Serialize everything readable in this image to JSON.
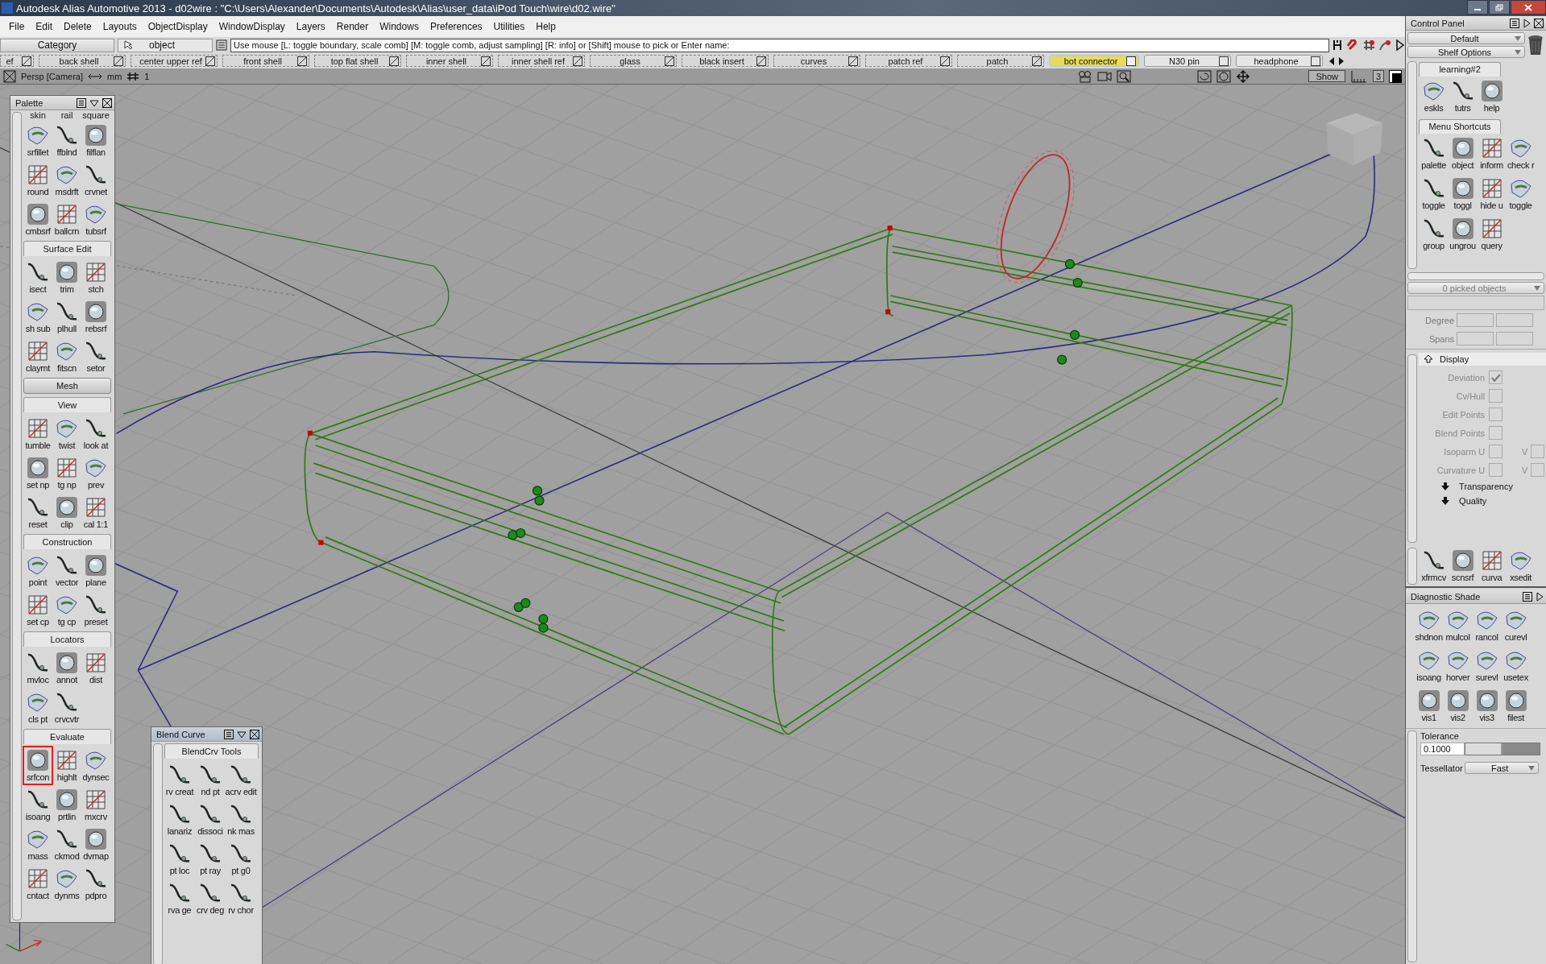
{
  "window": {
    "title": "Autodesk Alias Automotive 2013 - d02wire : \"C:\\Users\\Alexander\\Documents\\Autodesk\\Alias\\user_data\\iPod Touch\\wire\\d02.wire\""
  },
  "menu": [
    "File",
    "Edit",
    "Delete",
    "Layouts",
    "ObjectDisplay",
    "WindowDisplay",
    "Layers",
    "Render",
    "Windows",
    "Preferences",
    "Utilities",
    "Help"
  ],
  "prompt": {
    "category": "Category",
    "object": "object",
    "message": "Use mouse [L: toggle boundary, scale comb] [M: toggle comb, adjust sampling] [R: info] or [Shift] mouse to pick or Enter name:"
  },
  "layers": [
    {
      "label": "ef",
      "kind": "dashed",
      "selected": false
    },
    {
      "label": "back shell",
      "kind": "dashed",
      "selected": false
    },
    {
      "label": "center upper ref",
      "kind": "dashed",
      "selected": false
    },
    {
      "label": "front shell",
      "kind": "dashed",
      "selected": false
    },
    {
      "label": "top flat shell",
      "kind": "dashed",
      "selected": false
    },
    {
      "label": "inner shell",
      "kind": "dashed",
      "selected": false
    },
    {
      "label": "inner shell ref",
      "kind": "dashed",
      "selected": false
    },
    {
      "label": "glass",
      "kind": "dashed",
      "selected": false
    },
    {
      "label": "black insert",
      "kind": "dashed",
      "selected": false
    },
    {
      "label": "curves",
      "kind": "dashed",
      "selected": false
    },
    {
      "label": "patch ref",
      "kind": "dashed",
      "selected": false
    },
    {
      "label": "patch",
      "kind": "dashed",
      "selected": false
    },
    {
      "label": "bot connector",
      "kind": "solid",
      "selected": true
    },
    {
      "label": "N30 pin",
      "kind": "solid",
      "selected": false
    },
    {
      "label": "headphone",
      "kind": "solid",
      "selected": false
    }
  ],
  "view": {
    "camera": "Persp [Camera]",
    "units": "mm",
    "grid": "1",
    "show": "Show",
    "count": "3"
  },
  "palette": {
    "title": "Palette",
    "cut_labels": [
      "skin",
      "rail",
      "square"
    ],
    "sections": [
      {
        "items": [
          {
            "label": "srfillet",
            "selected": false
          },
          {
            "label": "ffblnd",
            "selected": false
          },
          {
            "label": "filflan",
            "selected": false
          },
          {
            "label": "round",
            "selected": false
          },
          {
            "label": "msdrft",
            "selected": false
          },
          {
            "label": "crvnet",
            "selected": false
          },
          {
            "label": "cmbsrf",
            "selected": false
          },
          {
            "label": "ballcrn",
            "selected": false
          },
          {
            "label": "tubsrf",
            "selected": false
          }
        ]
      },
      {
        "title": "Surface Edit",
        "expanded": true,
        "items": [
          {
            "label": "isect",
            "selected": false
          },
          {
            "label": "trim",
            "selected": false
          },
          {
            "label": "stch",
            "selected": false
          },
          {
            "label": "sh sub",
            "selected": false
          },
          {
            "label": "plhull",
            "selected": false
          },
          {
            "label": "rebsrf",
            "selected": false
          },
          {
            "label": "claymt",
            "selected": false
          },
          {
            "label": "fitscn",
            "selected": false
          },
          {
            "label": "setor",
            "selected": false
          }
        ]
      },
      {
        "title": "Mesh",
        "expanded": false
      },
      {
        "title": "View",
        "expanded": true,
        "items": [
          {
            "label": "tumble",
            "selected": false
          },
          {
            "label": "twist",
            "selected": false
          },
          {
            "label": "look at",
            "selected": false
          },
          {
            "label": "set np",
            "selected": false
          },
          {
            "label": "tg np",
            "selected": false
          },
          {
            "label": "prev",
            "selected": false
          },
          {
            "label": "reset",
            "selected": false
          },
          {
            "label": "clip",
            "selected": false
          },
          {
            "label": "cal 1:1",
            "selected": false
          }
        ]
      },
      {
        "title": "Construction",
        "expanded": true,
        "items": [
          {
            "label": "point",
            "selected": false
          },
          {
            "label": "vector",
            "selected": false
          },
          {
            "label": "plane",
            "selected": false
          },
          {
            "label": "set cp",
            "selected": false
          },
          {
            "label": "tg cp",
            "selected": false
          },
          {
            "label": "preset",
            "selected": false
          }
        ]
      },
      {
        "title": "Locators",
        "expanded": true,
        "items": [
          {
            "label": "mvloc",
            "selected": false
          },
          {
            "label": "annot",
            "selected": false
          },
          {
            "label": "dist",
            "selected": false
          },
          {
            "label": "cls pt",
            "selected": false
          },
          {
            "label": "crvcvtr",
            "selected": false
          }
        ]
      },
      {
        "title": "Evaluate",
        "expanded": true,
        "items": [
          {
            "label": "srfcon",
            "selected": true
          },
          {
            "label": "highlt",
            "selected": false
          },
          {
            "label": "dynsec",
            "selected": false
          },
          {
            "label": "isoang",
            "selected": false
          },
          {
            "label": "prtlin",
            "selected": false
          },
          {
            "label": "mxcrv",
            "selected": false
          },
          {
            "label": "mass",
            "selected": false
          },
          {
            "label": "ckmod",
            "selected": false
          },
          {
            "label": "dvmap",
            "selected": false
          },
          {
            "label": "cntact",
            "selected": false
          },
          {
            "label": "dynms",
            "selected": false
          },
          {
            "label": "pdpro",
            "selected": false
          }
        ]
      }
    ]
  },
  "blend_curve": {
    "title": "Blend Curve",
    "tab": "BlendCrv Tools",
    "items": [
      "rv creat",
      "nd pt",
      "acrv edit",
      "lanariz",
      "dissoci",
      "nk mas",
      "pt loc",
      "pt ray",
      "pt g0",
      "rva ge",
      "crv deg",
      "rv chor"
    ]
  },
  "control_panel": {
    "title": "Control Panel",
    "preset": "Default",
    "shelf_options": "Shelf Options",
    "shelves": [
      {
        "title": "learning#2",
        "items": [
          "eskls",
          "tutrs",
          "help"
        ]
      },
      {
        "title": "Menu Shortcuts",
        "items": [
          "palette",
          "object",
          "inform",
          "check r",
          "toggle",
          "toggl",
          "hide u",
          "toggle",
          "group",
          "ungrou",
          "query"
        ]
      }
    ],
    "picked": "0 picked objects",
    "degree": "Degree",
    "spans": "Spans",
    "display": {
      "title": "Display",
      "options": [
        {
          "label": "Deviation",
          "checked": true
        },
        {
          "label": "Cv/Hull",
          "checked": false
        },
        {
          "label": "Edit Points",
          "checked": false
        },
        {
          "label": "Blend Points",
          "checked": false
        },
        {
          "label": "Isoparm U",
          "checked": false,
          "v": {
            "label": "V",
            "checked": false
          }
        },
        {
          "label": "Curvature U",
          "checked": false,
          "v": {
            "label": "V",
            "checked": false
          }
        }
      ],
      "collapsed": [
        "Transparency",
        "Quality"
      ]
    },
    "tools": [
      "xfrmcv",
      "scnsrf",
      "curva",
      "xsedit"
    ]
  },
  "diagnostic": {
    "title": "Diagnostic Shade",
    "items": [
      "shdnon",
      "mulcol",
      "rancol",
      "curevl",
      "isoang",
      "horver",
      "surevl",
      "usetex",
      "vis1",
      "vis2",
      "vis3",
      "filest"
    ],
    "tolerance_label": "Tolerance",
    "tolerance": "0.1000",
    "level": 0.5,
    "tessellator_label": "Tessellator",
    "tessellator": "Fast"
  }
}
